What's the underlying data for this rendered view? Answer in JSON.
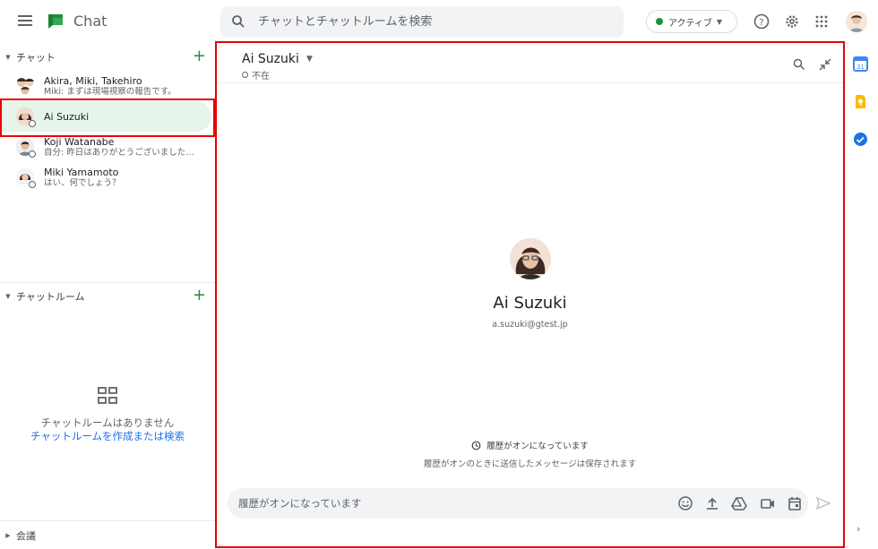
{
  "app": {
    "title": "Chat",
    "brand_color": "#1e8e3e"
  },
  "search": {
    "placeholder": "チャットとチャットルームを検索"
  },
  "status": {
    "label": "アクティブ",
    "color": "#1e8e3e"
  },
  "top_icons": [
    "help-icon",
    "settings-icon",
    "apps-grid-icon",
    "account-avatar"
  ],
  "sidebar": {
    "chat_section": {
      "title": "チャット"
    },
    "dms": [
      {
        "name": "Akira, Miki, Takehiro",
        "snippet": "Miki: まずは現場視察の報告です。"
      },
      {
        "name": "Ai Suzuki",
        "snippet": "",
        "active": true
      },
      {
        "name": "Koji Watanabe",
        "snippet": "自分: 昨日はありがとうございました…"
      },
      {
        "name": "Miki Yamamoto",
        "snippet": "はい、何でしょう？"
      }
    ],
    "rooms_section": {
      "title": "チャットルーム"
    },
    "rooms_empty": {
      "line1": "チャットルームはありません",
      "link": "チャットルームを作成または検索"
    },
    "meetings_section": {
      "title": "会議"
    }
  },
  "conversation": {
    "name": "Ai Suzuki",
    "presence": "不在",
    "profile": {
      "name": "Ai Suzuki",
      "email": "a.suzuki@gtest.jp"
    },
    "history_on": "履歴がオンになっています",
    "history_note": "履歴がオンのときに送信したメッセージは保存されます",
    "composer_placeholder": "履歴がオンになっています"
  },
  "highlight_color": "#ea0000"
}
